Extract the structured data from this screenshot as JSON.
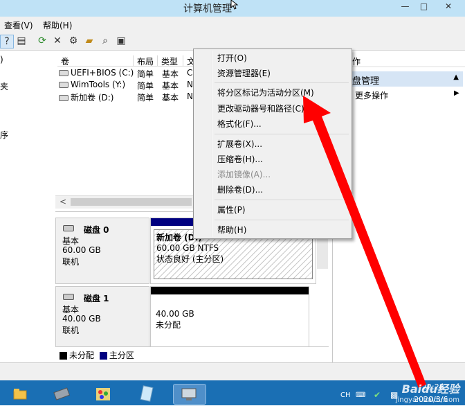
{
  "window": {
    "title": "计算机管理",
    "controls": {
      "minimize": "—",
      "maximize": "□",
      "close": "✕"
    }
  },
  "menubar": {
    "view": "查看(V)",
    "help": "帮助(H)"
  },
  "toolbar": {
    "icons": [
      "help-icon",
      "properties-icon",
      "refresh-icon",
      "delete-icon",
      "settings-icon",
      "open-folder-icon",
      "search-icon",
      "disk-icon"
    ]
  },
  "leftnav": {
    "items": [
      ")",
      "夹",
      "序"
    ]
  },
  "volume_list": {
    "columns": [
      "卷",
      "布局",
      "类型",
      "文"
    ],
    "rows": [
      {
        "name": "UEFI+BIOS (C:)",
        "layout": "简单",
        "type": "基本",
        "fs": "C"
      },
      {
        "name": "WimTools (Y:)",
        "layout": "简单",
        "type": "基本",
        "fs": "N"
      },
      {
        "name": "新加卷 (D:)",
        "layout": "简单",
        "type": "基本",
        "fs": "N"
      }
    ],
    "scroll_left": "<"
  },
  "disks": [
    {
      "name": "磁盘 0",
      "type": "基本",
      "size": "60.00 GB",
      "status": "联机",
      "partition": {
        "title": "新加卷  (D:)",
        "size": "60.00 GB NTFS",
        "status": "状态良好 (主分区)"
      }
    },
    {
      "name": "磁盘 1",
      "type": "基本",
      "size": "40.00 GB",
      "status": "联机",
      "partition": {
        "title": "",
        "size": "40.00 GB",
        "status": "未分配"
      }
    }
  ],
  "legend": {
    "unallocated": "未分配",
    "primary": "主分区"
  },
  "actions": {
    "header": "作",
    "section": "盘管理",
    "more": "更多操作"
  },
  "context_menu": {
    "items": [
      "打开(O)",
      "资源管理器(E)",
      "将分区标记为活动分区(M)",
      "更改驱动器号和路径(C)...",
      "格式化(F)...",
      "扩展卷(X)...",
      "压缩卷(H)...",
      "添加镜像(A)...",
      "删除卷(D)...",
      "属性(P)",
      "帮助(H)"
    ],
    "disabled": "添加镜像(A)..."
  },
  "taskbar": {
    "lang": "CH",
    "time": "22:28",
    "date": "2020/3/6"
  },
  "watermark": {
    "brand": "Baidu经验",
    "url": "jingyan.baidu.com"
  },
  "colors": {
    "titlebar": "#bfe2f6",
    "taskbar": "#1a6fb4",
    "primary_partition": "#000080",
    "unallocated": "#000000",
    "annotation_arrow": "#ff0000",
    "action_header": "#d6e5f5"
  }
}
